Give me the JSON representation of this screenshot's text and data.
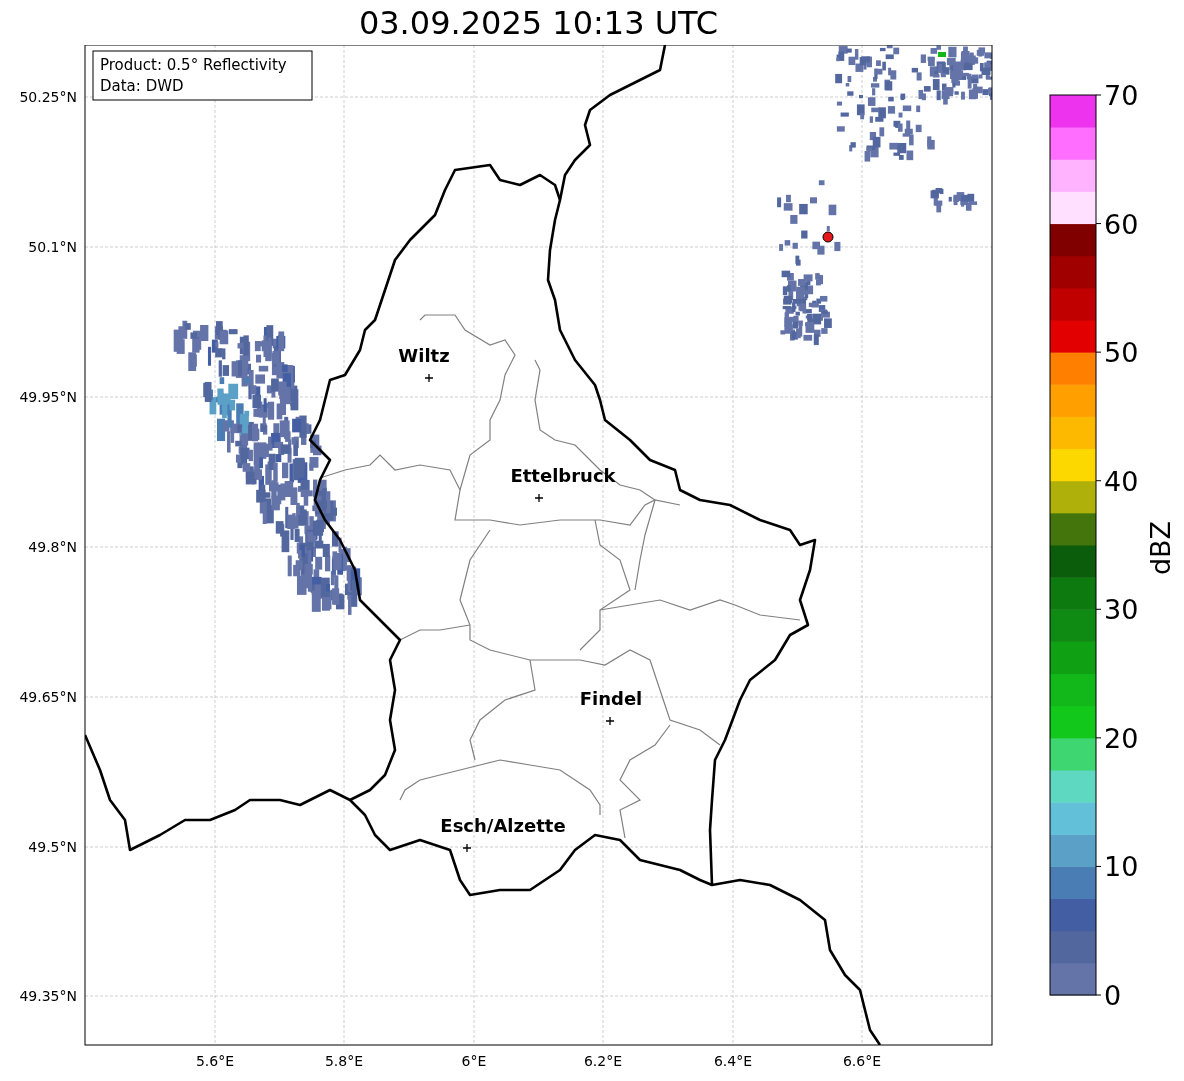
{
  "title": "03.09.2025 10:13 UTC",
  "info_box": [
    "Product: 0.5° Reflectivity",
    "Data: DWD"
  ],
  "map": {
    "lat_labels": [
      "50.25°N",
      "50.1°N",
      "49.95°N",
      "49.8°N",
      "49.65°N",
      "49.5°N",
      "49.35°N"
    ],
    "lon_labels": [
      "5.6°E",
      "5.8°E",
      "6°E",
      "6.2°E",
      "6.4°E",
      "6.6°E"
    ],
    "cities": [
      {
        "name": "Wiltz"
      },
      {
        "name": "Ettelbruck"
      },
      {
        "name": "Findel"
      },
      {
        "name": "Esch/Alzette"
      }
    ]
  },
  "colorbar": {
    "label": "dBZ",
    "ticks": [
      "70",
      "60",
      "50",
      "40",
      "30",
      "20",
      "10",
      "0"
    ],
    "bins": [
      {
        "color": "#6574a8"
      },
      {
        "color": "#53679f"
      },
      {
        "color": "#435ea3"
      },
      {
        "color": "#4a7db3"
      },
      {
        "color": "#5aa0c7"
      },
      {
        "color": "#62c1d8"
      },
      {
        "color": "#5fd8c2"
      },
      {
        "color": "#3dd670"
      },
      {
        "color": "#12c81a"
      },
      {
        "color": "#12b81a"
      },
      {
        "color": "#10a014"
      },
      {
        "color": "#0f8a12"
      },
      {
        "color": "#0d7a10"
      },
      {
        "color": "#0b5d0b"
      },
      {
        "color": "#44750c"
      },
      {
        "color": "#afb00a"
      },
      {
        "color": "#fdd800"
      },
      {
        "color": "#fdb800"
      },
      {
        "color": "#ff9f00"
      },
      {
        "color": "#ff8000"
      },
      {
        "color": "#e20000"
      },
      {
        "color": "#c00000"
      },
      {
        "color": "#a00000"
      },
      {
        "color": "#800000"
      },
      {
        "color": "#ffe0ff"
      },
      {
        "color": "#ffb3ff"
      },
      {
        "color": "#ff6eff"
      },
      {
        "color": "#ee33ee"
      }
    ]
  }
}
